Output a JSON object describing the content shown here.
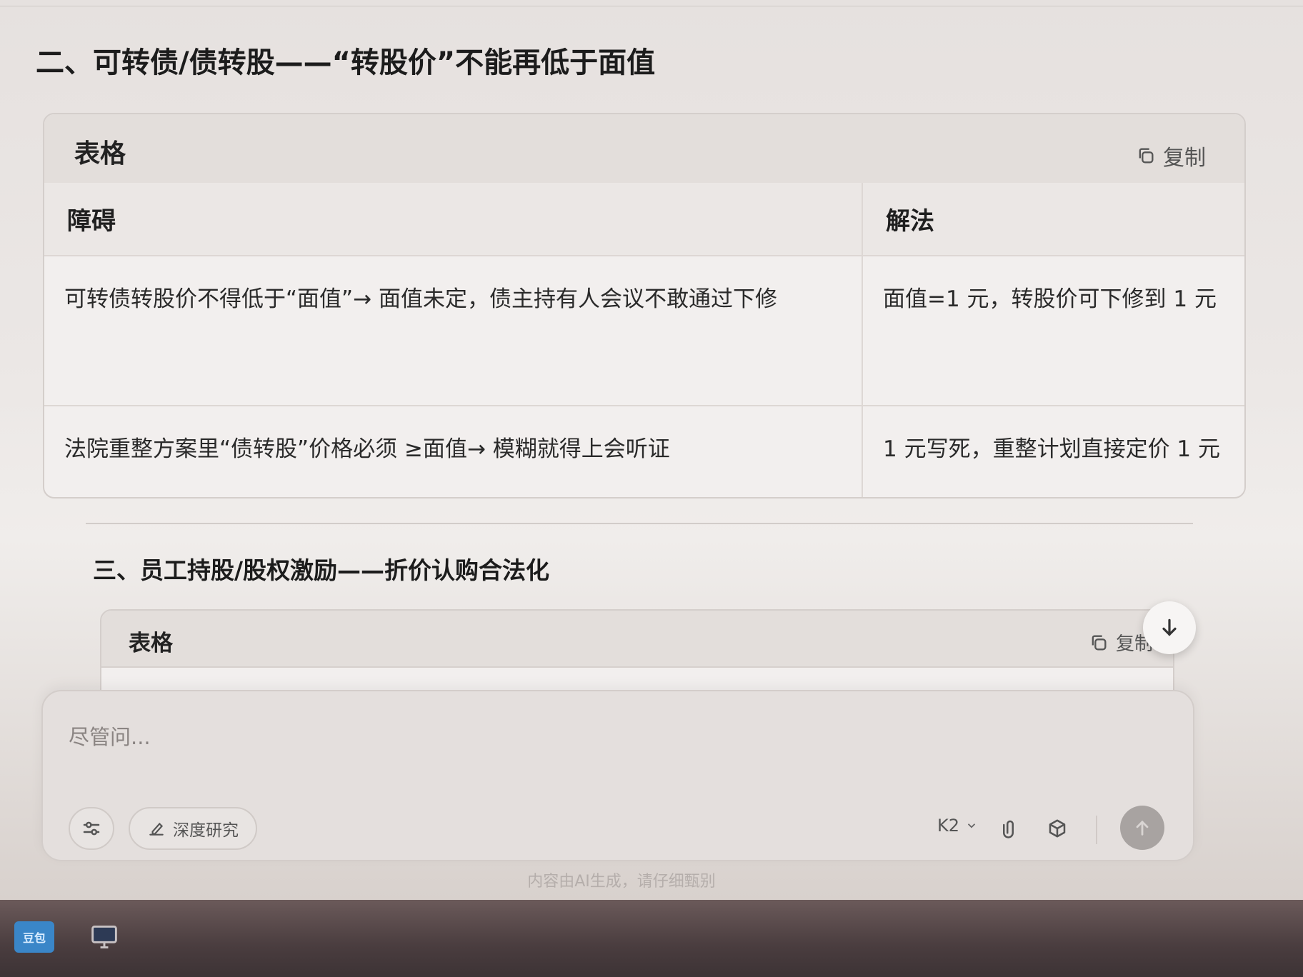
{
  "sections": [
    {
      "title": "二、可转债/债转股——“转股价”不能再低于面值",
      "table": {
        "label": "表格",
        "copy_label": "复制",
        "headers": [
          "障碍",
          "解法"
        ],
        "rows": [
          [
            "可转债转股价不得低于“面值”→ 面值未定，债主持有人会议不敢通过下修",
            "面值=1 元，转股价可下修到 1 元"
          ],
          [
            "法院重整方案里“债转股”价格必须 ≥面值→ 模糊就得上会听证",
            "1 元写死，重整计划直接定价 1 元"
          ]
        ]
      }
    },
    {
      "title": "三、员工持股/股权激励——折价认购合法化",
      "table": {
        "label": "表格",
        "copy_label": "复制"
      }
    }
  ],
  "composer": {
    "placeholder": "尽管问...",
    "deep_research_label": "深度研究",
    "model": "K2"
  },
  "footer": {
    "disclaimer": "内容由AI生成，请仔细甄别"
  },
  "taskbar": {
    "app1_label": "豆包"
  }
}
